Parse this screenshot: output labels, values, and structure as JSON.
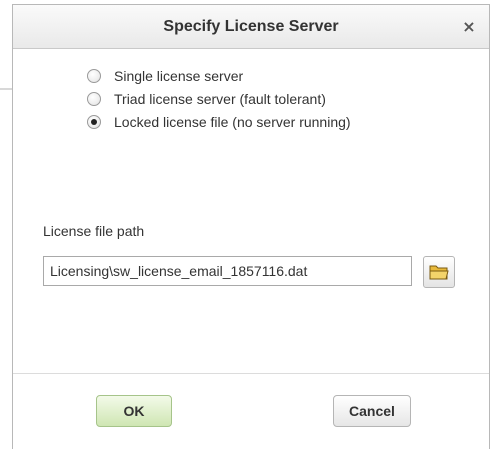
{
  "dialog": {
    "title": "Specify License Server",
    "close_glyph": "×"
  },
  "options": [
    {
      "label": "Single license server",
      "checked": false
    },
    {
      "label": "Triad license server (fault tolerant)",
      "checked": false
    },
    {
      "label": "Locked license file (no server running)",
      "checked": true
    }
  ],
  "license_path": {
    "label": "License file path",
    "value": "Licensing\\sw_license_email_1857116.dat",
    "browse_icon": "folder-icon"
  },
  "buttons": {
    "ok": "OK",
    "cancel": "Cancel"
  },
  "colors": {
    "ok_button_top": "#f3fae9",
    "ok_button_bottom": "#cfe6b3",
    "folder_icon": "#f3d36a"
  }
}
